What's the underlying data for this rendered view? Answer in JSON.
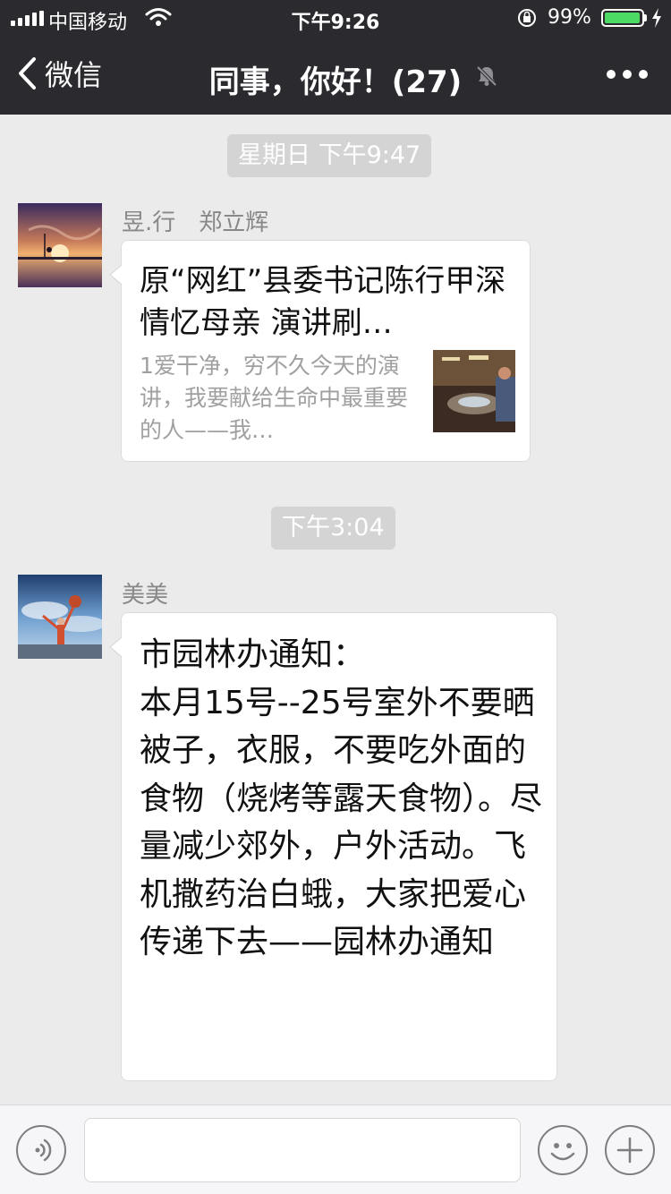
{
  "status_bar": {
    "carrier": "中国移动",
    "time": "下午9:26",
    "battery": "99%",
    "battery_level": 0.99
  },
  "nav": {
    "back_label": "微信",
    "title": "同事，你好！(27)"
  },
  "messages": [
    {
      "timestamp": "星期日 下午9:47",
      "sender": "昱.行　郑立辉",
      "type": "link",
      "link_title": "原“网红”县委书记陈行甲深情忆母亲 演讲刷…",
      "link_desc": "1爱干净，穷不久今天的演讲，我要献给生命中最重要的人——我…"
    },
    {
      "timestamp": "下午3:04",
      "sender": "美美",
      "type": "text",
      "text": "市园林办通知：\n本月15号--25号室外不要晒被子，衣服，不要吃外面的食物（烧烤等露天食物）。尽量减少郊外，户外活动。飞机撒药治白蛾，大家把爱心传递下去——园林办通知"
    }
  ],
  "input_bar": {
    "text_value": "",
    "icons": [
      "voice-icon",
      "emoji-icon",
      "plus-icon"
    ]
  },
  "colors": {
    "nav_bg": "#2b2b2f",
    "chat_bg": "#ebebeb",
    "battery": "#4cd964",
    "timestamp_bg": "#d4d4d4"
  }
}
